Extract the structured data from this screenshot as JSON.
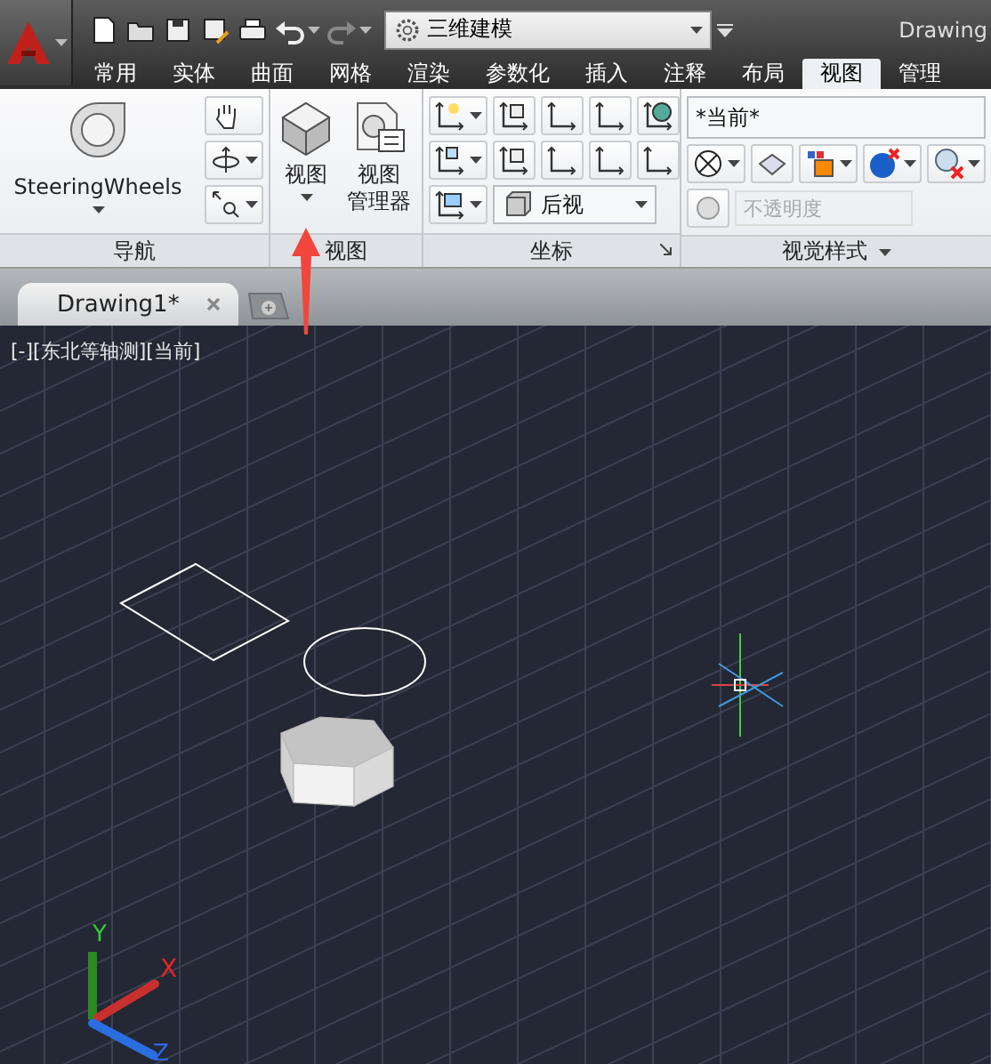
{
  "quick_access": {
    "workspace": "三维建模"
  },
  "window": {
    "title": "Drawing"
  },
  "ribbon_tabs": [
    {
      "label": "常用",
      "selected": false
    },
    {
      "label": "实体",
      "selected": false
    },
    {
      "label": "曲面",
      "selected": false
    },
    {
      "label": "网格",
      "selected": false
    },
    {
      "label": "渲染",
      "selected": false
    },
    {
      "label": "参数化",
      "selected": false
    },
    {
      "label": "插入",
      "selected": false
    },
    {
      "label": "注释",
      "selected": false
    },
    {
      "label": "布局",
      "selected": false
    },
    {
      "label": "视图",
      "selected": true
    },
    {
      "label": "管理",
      "selected": false
    }
  ],
  "navigation_panel": {
    "title": "导航",
    "steering_wheels": "SteeringWheels"
  },
  "view_panel": {
    "title": "视图",
    "buttons": [
      {
        "label_lines": [
          "视图"
        ],
        "kind": "view"
      },
      {
        "label_lines": [
          "视图",
          "管理器"
        ],
        "kind": "manager"
      }
    ]
  },
  "coordinates_panel": {
    "title": "坐标",
    "view_dropdown": "后视"
  },
  "visual_styles_panel": {
    "title": "视觉样式",
    "style_dropdown": "*当前*",
    "opacity_placeholder": "不透明度"
  },
  "document_tabs": [
    {
      "label": "Drawing1*",
      "selected": true
    }
  ],
  "viewport": {
    "label": "[-][东北等轴测][当前]",
    "ucs_axes": [
      "X",
      "Y",
      "Z"
    ]
  }
}
